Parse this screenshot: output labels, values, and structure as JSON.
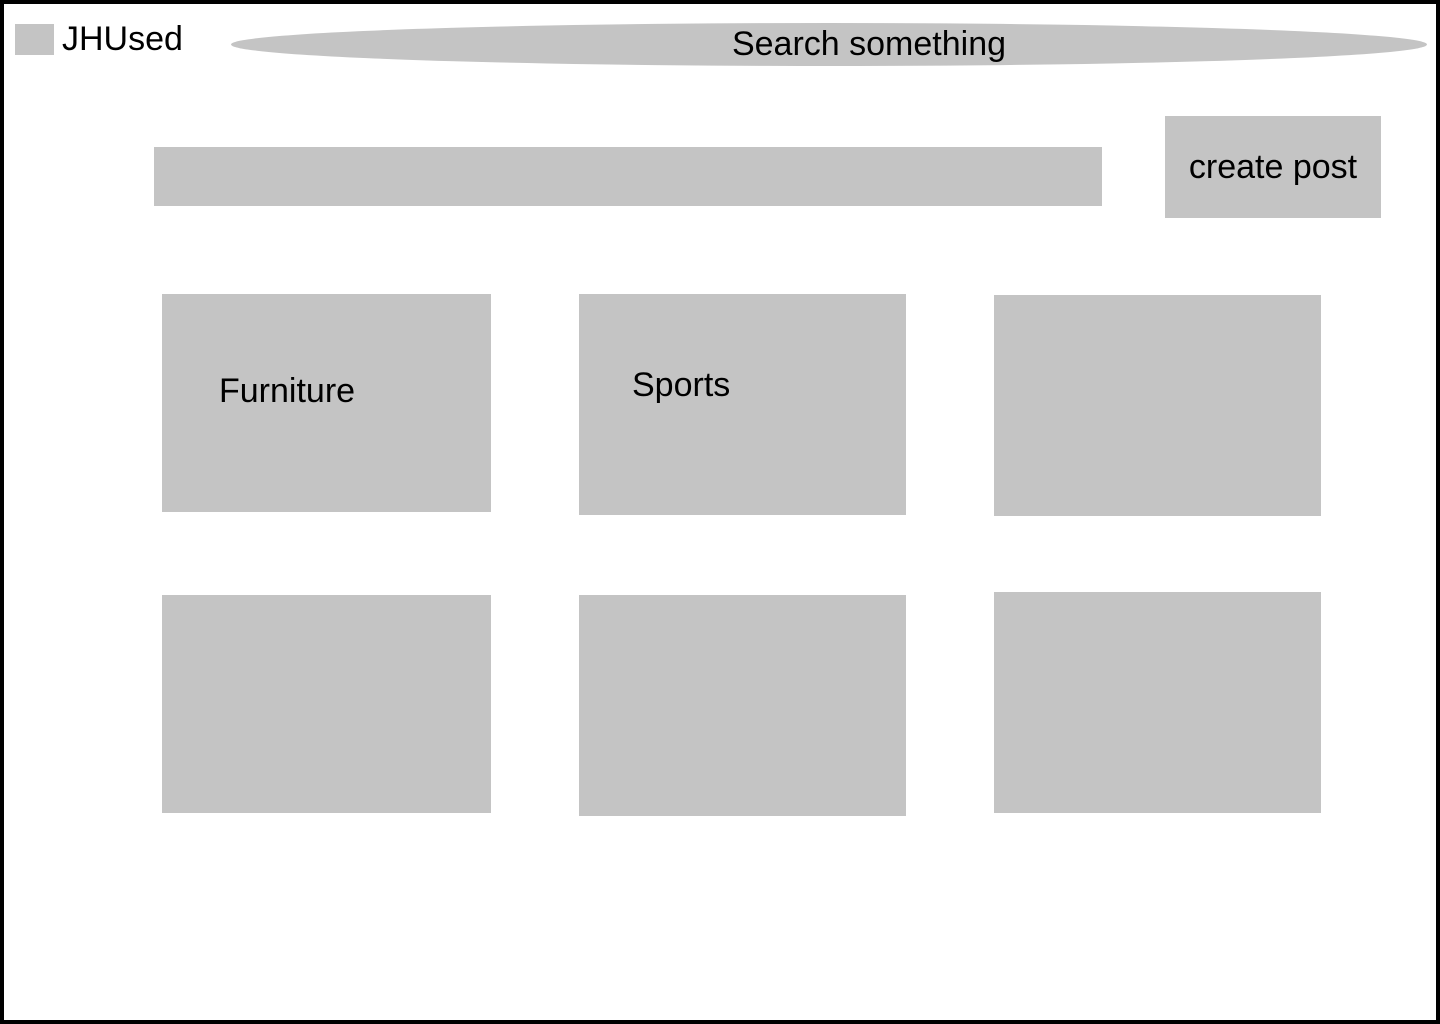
{
  "header": {
    "logo_text": "JHUsed",
    "search_placeholder": "Search something"
  },
  "toolbar": {
    "create_post_label": "create post"
  },
  "categories": [
    {
      "label": "Furniture"
    },
    {
      "label": "Sports"
    },
    {
      "label": ""
    },
    {
      "label": ""
    },
    {
      "label": ""
    },
    {
      "label": ""
    }
  ],
  "colors": {
    "placeholder_gray": "#c4c4c4",
    "border": "#000000"
  }
}
